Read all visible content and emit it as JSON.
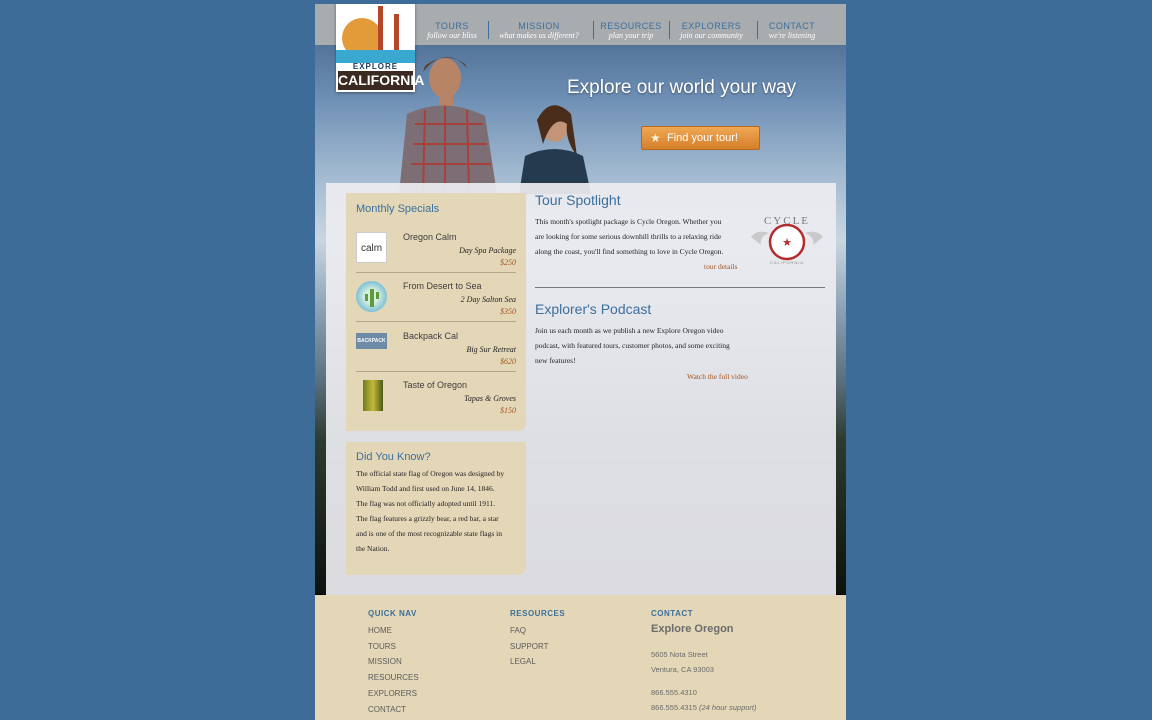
{
  "brand": {
    "explore": "EXPLORE",
    "name": "CALIFORNIA"
  },
  "nav": [
    {
      "title": "TOURS",
      "sub": "follow our bliss"
    },
    {
      "title": "MISSION",
      "sub": "what makes us different?"
    },
    {
      "title": "RESOURCES",
      "sub": "plan your trip"
    },
    {
      "title": "EXPLORERS",
      "sub": "join our community"
    },
    {
      "title": "CONTACT",
      "sub": "we're listening"
    }
  ],
  "hero": {
    "headline": "Explore our world your way",
    "button": "Find your tour!",
    "button_icon": "star-icon"
  },
  "specials": {
    "title": "Monthly Specials",
    "items": [
      {
        "name": "Oregon Calm",
        "package": "Day Spa Package",
        "price": "$250",
        "thumb": "calm"
      },
      {
        "name": "From Desert to Sea",
        "package": "2 Day Salton Sea",
        "price": "$350",
        "thumb": ""
      },
      {
        "name": "Backpack Cal",
        "package": "Big Sur Retreat",
        "price": "$620",
        "thumb": "BACKPACK CAL"
      },
      {
        "name": "Taste of Oregon",
        "package": "Tapas & Groves",
        "price": "$150",
        "thumb": ""
      }
    ]
  },
  "did_you_know": {
    "title": "Did You Know?",
    "lines": [
      "The official state flag of Oregon was designed by",
      "William Todd and first used on June 14, 1846.",
      "The flag was not officially adopted until 1911.",
      "The flag features a grizzly bear, a red bar, a star",
      "and is one of the most recognizable state flags in",
      "the Nation."
    ]
  },
  "spotlight": {
    "title": "Tour Spotlight",
    "lines": [
      "This month's spotlight package is Cycle Oregon. Whether you",
      "are looking for some serious downhill thrills to a relaxing ride",
      "along the coast, you'll find something to love in Cycle Oregon."
    ],
    "link": "tour details",
    "badge_top": "CYCLE",
    "badge_bottom": "CALIFORNIA"
  },
  "podcast": {
    "title": "Explorer's Podcast",
    "lines": [
      "Join us each month as we publish a new Explore Oregon video",
      "podcast, with featured tours, customer photos, and some exciting",
      "new features!"
    ],
    "link": "Watch the full video"
  },
  "footer": {
    "quick_nav": {
      "heading": "QUICK NAV",
      "links": [
        "HOME",
        "TOURS",
        "MISSION",
        "RESOURCES",
        "EXPLORERS",
        "CONTACT"
      ]
    },
    "resources": {
      "heading": "RESOURCES",
      "links": [
        "FAQ",
        "SUPPORT",
        "LEGAL"
      ]
    },
    "contact": {
      "heading": "CONTACT",
      "org": "Explore Oregon",
      "address1": "5605 Nota Street",
      "address2": "Ventura, CA 93003",
      "phone1": "866.555.4310",
      "phone2": "866.555.4315",
      "phone2_note": "(24 hour support)"
    }
  }
}
